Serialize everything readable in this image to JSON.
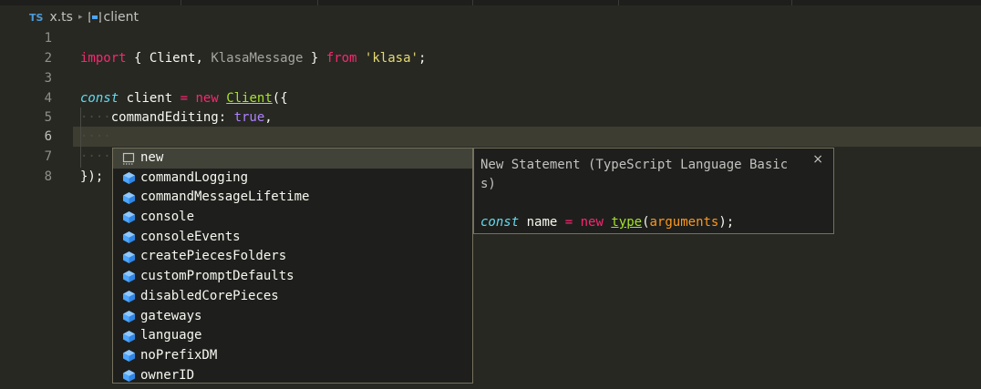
{
  "breadcrumb": {
    "lang_badge": "TS",
    "file": "x.ts",
    "separator": "▸",
    "symbol": "client"
  },
  "line_numbers": [
    "1",
    "2",
    "3",
    "4",
    "5",
    "6",
    "7",
    "8"
  ],
  "active_line": 6,
  "code": {
    "line2": {
      "import_kw": "import",
      "open": " { ",
      "ident1": "Client",
      "comma": ", ",
      "ident2": "KlasaMessage",
      "close": " } ",
      "from_kw": "from",
      "space": " ",
      "module": "'klasa'",
      "semi": ";"
    },
    "line4": {
      "const_kw": "const",
      "name": " client ",
      "eq": "=",
      "space": " ",
      "new_kw": "new",
      "space2": " ",
      "cls": "Client",
      "open": "({"
    },
    "line5": {
      "indent": "····",
      "prop": "commandEditing: ",
      "value": "true",
      "comma": ","
    },
    "line6": {
      "indent": "····"
    },
    "line7": {
      "indent": "····"
    },
    "line8": {
      "close": "});"
    }
  },
  "suggestions": {
    "selected_index": 0,
    "items": [
      {
        "label": "new",
        "icon": "snippet-icon"
      },
      {
        "label": "commandLogging",
        "icon": "property-icon"
      },
      {
        "label": "commandMessageLifetime",
        "icon": "property-icon"
      },
      {
        "label": "console",
        "icon": "property-icon"
      },
      {
        "label": "consoleEvents",
        "icon": "property-icon"
      },
      {
        "label": "createPiecesFolders",
        "icon": "property-icon"
      },
      {
        "label": "customPromptDefaults",
        "icon": "property-icon"
      },
      {
        "label": "disabledCorePieces",
        "icon": "property-icon"
      },
      {
        "label": "gateways",
        "icon": "property-icon"
      },
      {
        "label": "language",
        "icon": "property-icon"
      },
      {
        "label": "noPrefixDM",
        "icon": "property-icon"
      },
      {
        "label": "ownerID",
        "icon": "property-icon"
      }
    ]
  },
  "details": {
    "title": "New Statement (TypeScript Language Basics)",
    "close": "×",
    "code": {
      "const_kw": "const",
      "name": " name ",
      "eq": "=",
      "sp": " ",
      "new_kw": "new",
      "sp2": " ",
      "type": "type",
      "open": "(",
      "args": "arguments",
      "close": ");"
    }
  },
  "colors": {
    "background": "#272822",
    "keyword": "#f92672",
    "storage": "#66d9ef",
    "string": "#e6db74",
    "constant": "#ae81ff",
    "class": "#a6e22e",
    "param": "#fd971f",
    "property_icon": "#4da6ff"
  }
}
